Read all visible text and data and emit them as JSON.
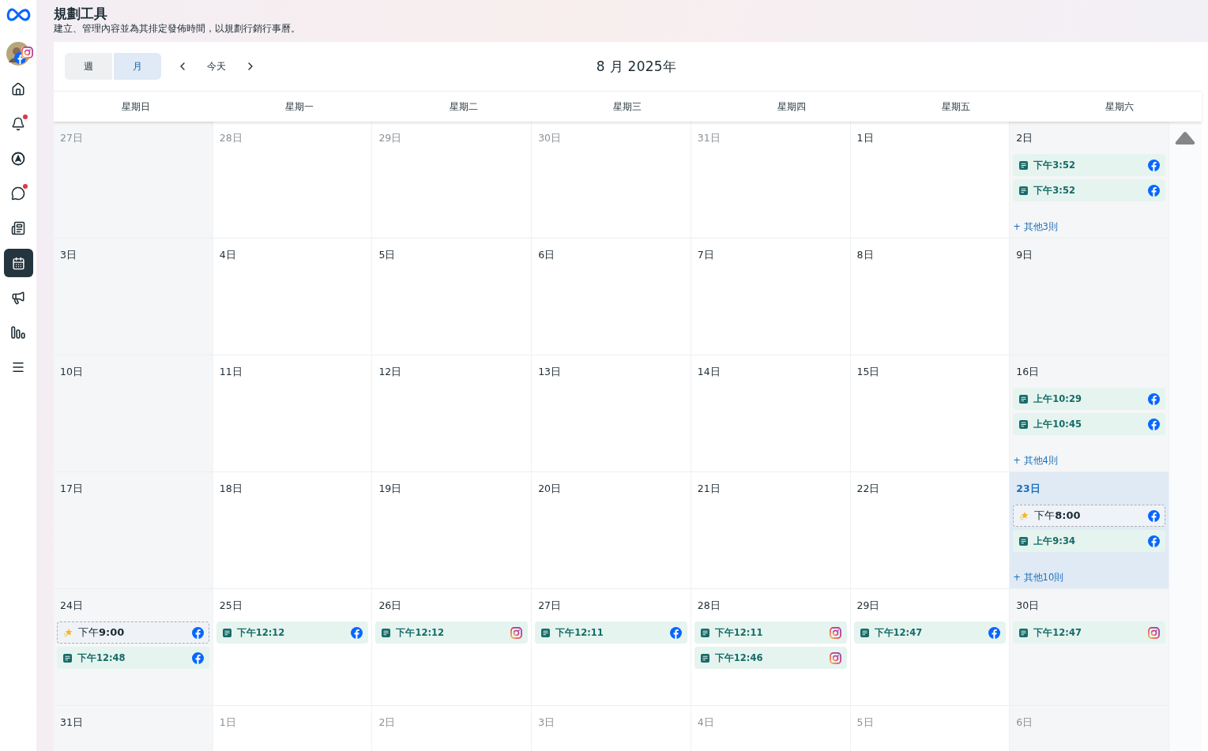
{
  "sidebar": {
    "items": [
      {
        "kind": "home",
        "selected": false,
        "dot": false
      },
      {
        "kind": "bell",
        "selected": false,
        "dot": true
      },
      {
        "kind": "compass",
        "selected": false,
        "dot": false
      },
      {
        "kind": "chat",
        "selected": false,
        "dot": true
      },
      {
        "kind": "content",
        "selected": false,
        "dot": false
      },
      {
        "kind": "calendar",
        "selected": true,
        "dot": false
      },
      {
        "kind": "megaphone",
        "selected": false,
        "dot": false
      },
      {
        "kind": "chart",
        "selected": false,
        "dot": false
      },
      {
        "kind": "menu",
        "selected": false,
        "dot": false
      }
    ]
  },
  "header": {
    "title": "規劃工具",
    "subtitle": "建立、管理內容並為其排定發佈時間，以規劃行銷行事曆。"
  },
  "toolbar": {
    "views": [
      {
        "label": "週",
        "selected": false
      },
      {
        "label": "月",
        "selected": true
      }
    ],
    "today": "今天",
    "month_title": "8 月 2025年"
  },
  "weekdays": [
    "星期日",
    "星期一",
    "星期二",
    "星期三",
    "星期四",
    "星期五",
    "星期六"
  ],
  "weeks": [
    {
      "days": [
        {
          "date": "27日",
          "in_month": false,
          "selected": false
        },
        {
          "date": "28日",
          "in_month": false,
          "selected": false
        },
        {
          "date": "29日",
          "in_month": false,
          "selected": false
        },
        {
          "date": "30日",
          "in_month": false,
          "selected": false
        },
        {
          "date": "31日",
          "in_month": false,
          "selected": false
        },
        {
          "date": "1日",
          "in_month": true,
          "selected": false
        },
        {
          "date": "2日",
          "in_month": true,
          "selected": false,
          "events": [
            {
              "kind": "facebook-post",
              "time": "下午3:52"
            },
            {
              "kind": "facebook-post",
              "time": "下午3:52"
            }
          ],
          "more": "+ 其他3則"
        }
      ]
    },
    {
      "days": [
        {
          "date": "3日",
          "in_month": true,
          "selected": false
        },
        {
          "date": "4日",
          "in_month": true,
          "selected": false
        },
        {
          "date": "5日",
          "in_month": true,
          "selected": false
        },
        {
          "date": "6日",
          "in_month": true,
          "selected": false
        },
        {
          "date": "7日",
          "in_month": true,
          "selected": false
        },
        {
          "date": "8日",
          "in_month": true,
          "selected": false
        },
        {
          "date": "9日",
          "in_month": true,
          "selected": false
        }
      ]
    },
    {
      "days": [
        {
          "date": "10日",
          "in_month": true,
          "selected": false
        },
        {
          "date": "11日",
          "in_month": true,
          "selected": false
        },
        {
          "date": "12日",
          "in_month": true,
          "selected": false
        },
        {
          "date": "13日",
          "in_month": true,
          "selected": false
        },
        {
          "date": "14日",
          "in_month": true,
          "selected": false
        },
        {
          "date": "15日",
          "in_month": true,
          "selected": false
        },
        {
          "date": "16日",
          "in_month": true,
          "selected": false,
          "events": [
            {
              "kind": "facebook-post",
              "time": "上午10:29"
            },
            {
              "kind": "facebook-post",
              "time": "上午10:45"
            }
          ],
          "more": "+ 其他4則"
        }
      ]
    },
    {
      "days": [
        {
          "date": "17日",
          "in_month": true,
          "selected": false
        },
        {
          "date": "18日",
          "in_month": true,
          "selected": false
        },
        {
          "date": "19日",
          "in_month": true,
          "selected": false
        },
        {
          "date": "20日",
          "in_month": true,
          "selected": false
        },
        {
          "date": "21日",
          "in_month": true,
          "selected": false
        },
        {
          "date": "22日",
          "in_month": true,
          "selected": false
        },
        {
          "date": "23日",
          "in_month": true,
          "selected": true,
          "events": [
            {
              "kind": "facebook-draft",
              "time": "下午**8:00**"
            },
            {
              "kind": "facebook-post",
              "time": "上午9:34"
            }
          ],
          "more": "+ 其他10則"
        }
      ]
    },
    {
      "days": [
        {
          "date": "24日",
          "in_month": true,
          "selected": false,
          "events": [
            {
              "kind": "facebook-draft",
              "time": "下午**9:00**"
            },
            {
              "kind": "facebook-post",
              "time": "下午12:48"
            }
          ]
        },
        {
          "date": "25日",
          "in_month": true,
          "selected": false,
          "events": [
            {
              "kind": "facebook-post",
              "time": "下午12:12"
            }
          ]
        },
        {
          "date": "26日",
          "in_month": true,
          "selected": false,
          "events": [
            {
              "kind": "instagram-post",
              "time": "下午12:12"
            }
          ]
        },
        {
          "date": "27日",
          "in_month": true,
          "selected": false,
          "events": [
            {
              "kind": "facebook-post",
              "time": "下午12:11"
            }
          ]
        },
        {
          "date": "28日",
          "in_month": true,
          "selected": false,
          "events": [
            {
              "kind": "instagram-post",
              "time": "下午12:11"
            },
            {
              "kind": "instagram-post",
              "time": "下午12:46"
            }
          ]
        },
        {
          "date": "29日",
          "in_month": true,
          "selected": false,
          "events": [
            {
              "kind": "facebook-post",
              "time": "下午12:47"
            }
          ]
        },
        {
          "date": "30日",
          "in_month": true,
          "selected": false,
          "events": [
            {
              "kind": "instagram-post",
              "time": "下午12:47"
            }
          ]
        }
      ]
    },
    {
      "days": [
        {
          "date": "31日",
          "in_month": true,
          "selected": false
        },
        {
          "date": "1日",
          "in_month": false,
          "selected": false
        },
        {
          "date": "2日",
          "in_month": false,
          "selected": false
        },
        {
          "date": "3日",
          "in_month": false,
          "selected": false
        },
        {
          "date": "4日",
          "in_month": false,
          "selected": false
        },
        {
          "date": "5日",
          "in_month": false,
          "selected": false
        },
        {
          "date": "6日",
          "in_month": false,
          "selected": false
        }
      ]
    }
  ]
}
